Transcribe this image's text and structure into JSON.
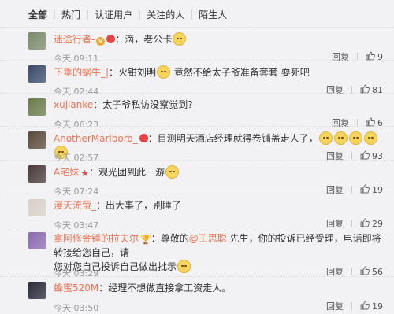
{
  "tabs": [
    "全部",
    "热门",
    "认证用户",
    "关注的人",
    "陌生人"
  ],
  "reply_label": "回复",
  "comments": [
    {
      "user": "迷途行者-",
      "badges": [
        "v",
        "crown"
      ],
      "text": "：滴，老公卡",
      "emoji_after": 1,
      "time": "今天 09:11",
      "likes": "9",
      "avatar_color": "#7a8a6a"
    },
    {
      "user": "下垂的蜗牛_|",
      "badges": [],
      "text": "：火钳刘明",
      "emoji_after": 1,
      "text2": "  竟然不给太子爷准备套套  耍死吧",
      "time": "今天 02:44",
      "likes": "81",
      "avatar_color": "#3a4a6a"
    },
    {
      "user": "xujianke",
      "badges": [],
      "text": "：太子爷私访没察觉到?",
      "emoji_after": 0,
      "time": "今天 06:23",
      "likes": "6",
      "avatar_color": "#6a7a4a"
    },
    {
      "user": "AnotherMarlboro_",
      "badges": [
        "crown"
      ],
      "text": "：目测明天酒店经理就得卷铺盖走人了，",
      "emoji_after": 5,
      "time": "今天 02:57",
      "likes": "93",
      "avatar_color": "#5a4a3a"
    },
    {
      "user": "A宅妹",
      "badges": [
        "star"
      ],
      "text": "：观光团到此一游",
      "emoji_after": 1,
      "time": "今天 07:24",
      "likes": "19",
      "avatar_color": "#4a3a3a"
    },
    {
      "user": "漫天流萤_",
      "badges": [],
      "text": "：出大事了，别睡了",
      "emoji_after": 0,
      "time": "今天 03:47",
      "likes": "29",
      "avatar_color": "#d8d0c8"
    },
    {
      "user": "拿阿修金锤的拉夫尔",
      "badges": [
        "cup"
      ],
      "text": "：尊敬的",
      "mention": "@王思聪",
      "text_after_mention": " 先生，你的投诉已经受理，电话即将转接给您自己，请",
      "text_line2": "您对您自己投诉自己做出批示",
      "emoji_after": 1,
      "time": "今天 03:29",
      "likes": "56",
      "avatar_color": "#8a6ab0"
    },
    {
      "user": "蜂蜜520M",
      "badges": [],
      "text": "：经理不想做直接拿工资走人。",
      "emoji_after": 0,
      "time": "今天 03:50",
      "likes": "19",
      "avatar_color": "#2a2a3a"
    }
  ],
  "colors": {
    "username": "#eb7350",
    "meta": "#999999",
    "background": "#f2f2f5"
  }
}
